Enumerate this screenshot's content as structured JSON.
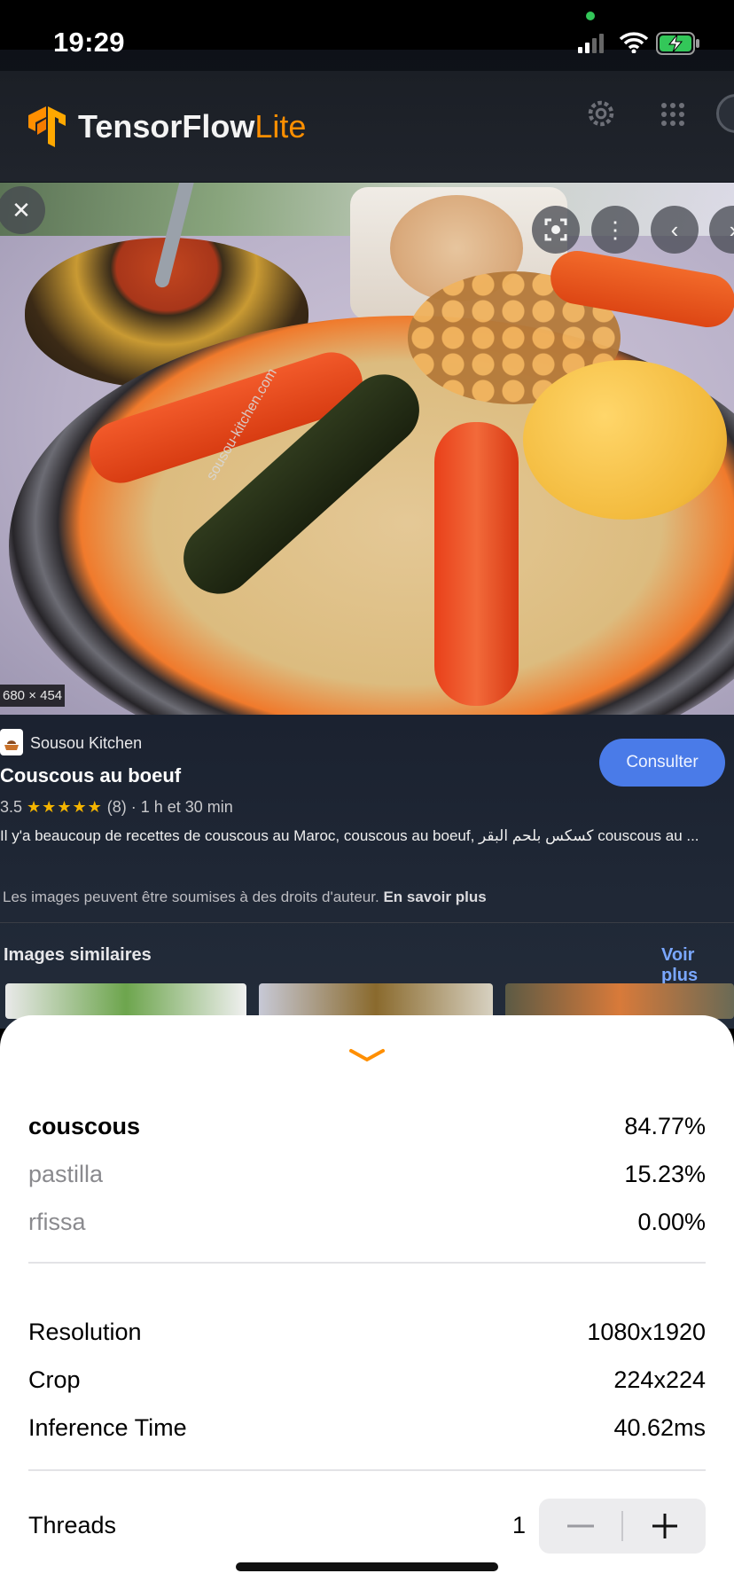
{
  "status_bar": {
    "time": "19:29"
  },
  "header": {
    "brand_main": "TensorFlow",
    "brand_lite": "Lite"
  },
  "photo": {
    "dimensions": "680 × 454",
    "watermark": "sousou-kitchen.com"
  },
  "result": {
    "source": "Sousou Kitchen",
    "title": "Couscous au boeuf",
    "rating": "3.5",
    "stars": "★★★★★",
    "reviews": "(8)",
    "duration": "1 h et 30 min",
    "description": "Il y'a beaucoup de recettes de couscous au Maroc, couscous au boeuf, كسكس بلحم البقر couscous au ...",
    "rights_text": "Les images peuvent être soumises à des droits d'auteur.",
    "rights_link": "En savoir plus",
    "consult_label": "Consulter",
    "similar_label": "Images similaires",
    "see_more_label": "Voir plus"
  },
  "classifications": [
    {
      "label": "couscous",
      "score": "84.77%"
    },
    {
      "label": "pastilla",
      "score": "15.23%"
    },
    {
      "label": "rfissa",
      "score": "0.00%"
    }
  ],
  "info": [
    {
      "label": "Resolution",
      "value": "1080x1920"
    },
    {
      "label": "Crop",
      "value": "224x224"
    },
    {
      "label": "Inference Time",
      "value": "40.62ms"
    }
  ],
  "threads": {
    "label": "Threads",
    "value": "1"
  },
  "colors": {
    "accent": "#ff8f00",
    "consult_button": "#4a7be8",
    "link": "#7aa7ff"
  },
  "icons": [
    "gear-icon",
    "grid-icon",
    "close-icon",
    "lens-icon",
    "more-vert-icon",
    "chevron-left-icon",
    "chevron-down-icon",
    "minus-icon",
    "plus-icon"
  ]
}
